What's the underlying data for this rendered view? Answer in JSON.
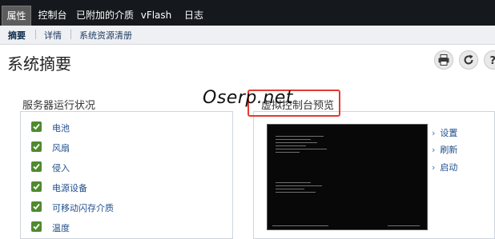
{
  "tabs": [
    {
      "label": "属性"
    },
    {
      "label": "控制台"
    },
    {
      "label": "已附加的介质"
    },
    {
      "label": "vFlash"
    },
    {
      "label": "日志"
    }
  ],
  "subtabs": [
    {
      "label": "摘要"
    },
    {
      "label": "详情"
    },
    {
      "label": "系统资源清册"
    }
  ],
  "page": {
    "title": "系统摘要"
  },
  "toolbar": {
    "icons": [
      "print-icon",
      "refresh-icon",
      "help-icon"
    ]
  },
  "health": {
    "title": "服务器运行状况",
    "items": [
      {
        "label": "电池",
        "status": "ok"
      },
      {
        "label": "风扇",
        "status": "ok"
      },
      {
        "label": "侵入",
        "status": "ok"
      },
      {
        "label": "电源设备",
        "status": "ok"
      },
      {
        "label": "可移动闪存介质",
        "status": "ok"
      },
      {
        "label": "温度",
        "status": "ok"
      }
    ]
  },
  "console": {
    "title": "虚拟控制台预览",
    "actions": [
      {
        "label": "设置"
      },
      {
        "label": "刷新"
      },
      {
        "label": "启动"
      }
    ]
  },
  "watermark": {
    "text": "Oserp.net"
  },
  "colors": {
    "topbar": "#15181c",
    "active_tab": "#5c5c5c",
    "check": "#4f8a2e",
    "link": "#1f4e8c",
    "highlight": "#e23a32"
  }
}
